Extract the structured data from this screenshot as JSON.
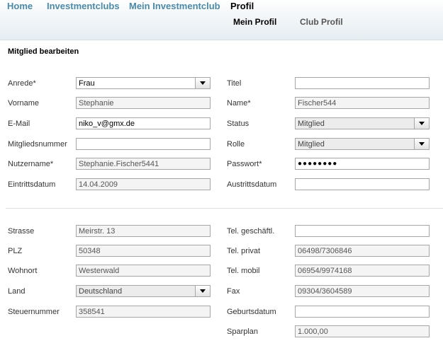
{
  "nav": {
    "home": "Home",
    "investmentclubs": "Investmentclubs",
    "mein_investmentclub": "Mein Investmentclub",
    "profil": "Profil",
    "sub_mein_profil": "Mein Profil",
    "sub_club_profil": "Club Profil"
  },
  "form": {
    "title": "Mitglied bearbeiten",
    "anrede": {
      "label": "Anrede*",
      "value": "Frau"
    },
    "titel": {
      "label": "Titel",
      "value": ""
    },
    "vorname": {
      "label": "Vorname",
      "value": "Stephanie"
    },
    "name": {
      "label": "Name*",
      "value": "Fischer544"
    },
    "email": {
      "label": "E-Mail",
      "value": "niko_v@gmx.de"
    },
    "status": {
      "label": "Status",
      "value": "Mitglied"
    },
    "mitgliedsnummer": {
      "label": "Mitgliedsnummer",
      "value": ""
    },
    "rolle": {
      "label": "Rolle",
      "value": "Mitglied"
    },
    "nutzername": {
      "label": "Nutzername*",
      "value": "Stephanie.Fischer5441"
    },
    "passwort": {
      "label": "Passwort*",
      "value": "●●●●●●●●"
    },
    "eintrittsdatum": {
      "label": "Eintrittsdatum",
      "value": "14.04.2009"
    },
    "austrittsdatum": {
      "label": "Austrittsdatum",
      "value": ""
    },
    "strasse": {
      "label": "Strasse",
      "value": "Meirstr. 13"
    },
    "tel_geschaeftl": {
      "label": "Tel. geschäftl.",
      "value": ""
    },
    "plz": {
      "label": "PLZ",
      "value": "50348"
    },
    "tel_privat": {
      "label": "Tel. privat",
      "value": "06498/7306846"
    },
    "wohnort": {
      "label": "Wohnort",
      "value": "Westerwald"
    },
    "tel_mobil": {
      "label": "Tel. mobil",
      "value": "06954/9974168"
    },
    "land": {
      "label": "Land",
      "value": "Deutschland"
    },
    "fax": {
      "label": "Fax",
      "value": "09304/3604589"
    },
    "steuernummer": {
      "label": "Steuernummer",
      "value": "358541"
    },
    "geburtsdatum": {
      "label": "Geburtsdatum",
      "value": ""
    },
    "sparplan": {
      "label": "Sparplan",
      "value": "1.000,00"
    }
  }
}
